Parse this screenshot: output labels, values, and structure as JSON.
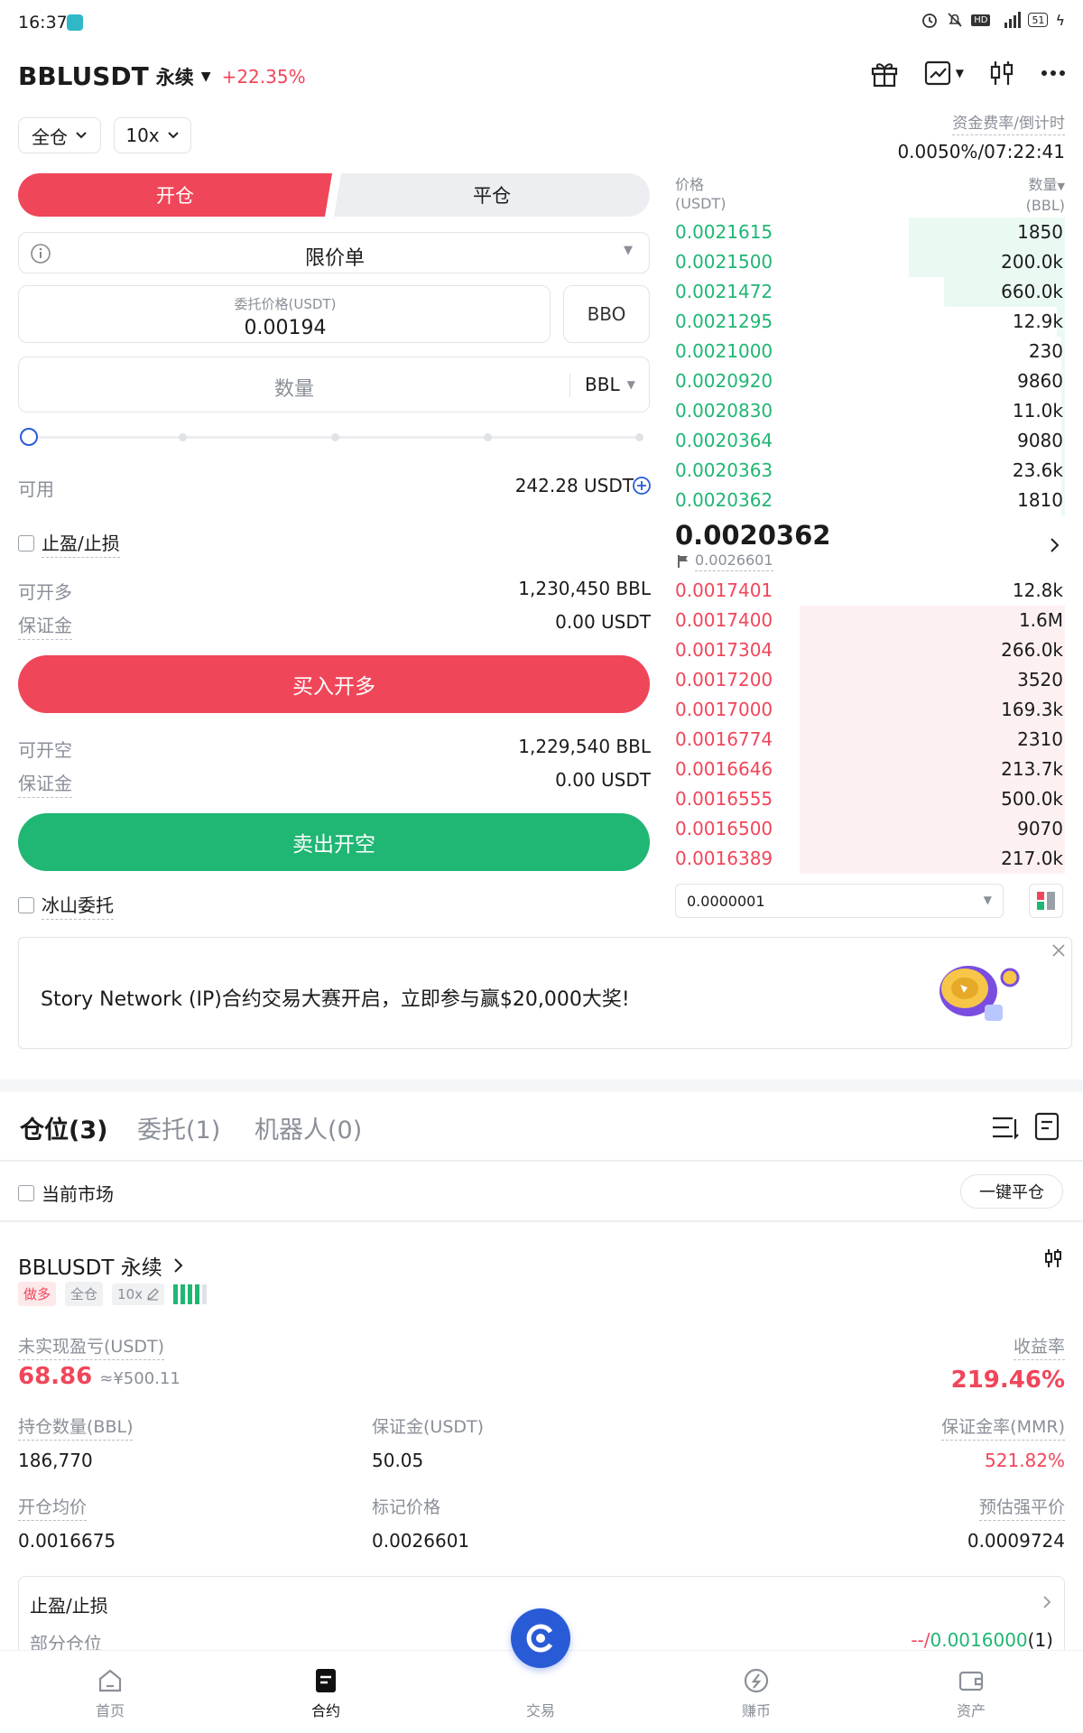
{
  "status_bar": {
    "time": "16:37",
    "battery": "51"
  },
  "header": {
    "symbol": "BBLUSDT",
    "type": "永续",
    "change": "+22.35%"
  },
  "margin_mode": "全仓",
  "leverage": "10x",
  "funding": {
    "label": "资金费率/倒计时",
    "value": "0.0050%/07:22:41"
  },
  "order_tabs": {
    "open": "开仓",
    "close": "平仓"
  },
  "order_type": "限价单",
  "price_input": {
    "label": "委托价格(USDT)",
    "value": "0.00194",
    "bbo": "BBO"
  },
  "qty_input": {
    "placeholder": "数量",
    "unit": "BBL"
  },
  "slider_level": 0,
  "available": {
    "label": "可用",
    "value": "242.28 USDT"
  },
  "tpsl_label": "止盈/止损",
  "long": {
    "can_open_label": "可开多",
    "can_open_value": "1,230,450 BBL",
    "margin_label": "保证金",
    "margin_value": "0.00 USDT",
    "button": "买入开多"
  },
  "short": {
    "can_open_label": "可开空",
    "can_open_value": "1,229,540 BBL",
    "margin_label": "保证金",
    "margin_value": "0.00 USDT",
    "button": "卖出开空"
  },
  "iceberg_label": "冰山委托",
  "orderbook": {
    "price_header": "价格",
    "price_unit": "(USDT)",
    "qty_header": "数量",
    "qty_unit": "(BBL)",
    "asks": [
      {
        "price": "0.0021615",
        "qty": "1850",
        "depth": 0.4
      },
      {
        "price": "0.0021500",
        "qty": "200.0k",
        "depth": 0.4
      },
      {
        "price": "0.0021472",
        "qty": "660.0k",
        "depth": 0.31
      },
      {
        "price": "0.0021295",
        "qty": "12.9k",
        "depth": 0.02
      },
      {
        "price": "0.0021000",
        "qty": "230",
        "depth": 0.01
      },
      {
        "price": "0.0020920",
        "qty": "9860",
        "depth": 0.01
      },
      {
        "price": "0.0020830",
        "qty": "11.0k",
        "depth": 0.01
      },
      {
        "price": "0.0020364",
        "qty": "9080",
        "depth": 0.01
      },
      {
        "price": "0.0020363",
        "qty": "23.6k",
        "depth": 0.01
      },
      {
        "price": "0.0020362",
        "qty": "1810",
        "depth": 0.01
      }
    ],
    "last_price": "0.0020362",
    "mark_price": "0.0026601",
    "bids": [
      {
        "price": "0.0017401",
        "qty": "12.8k",
        "depth": 0
      },
      {
        "price": "0.0017400",
        "qty": "1.6M",
        "depth": 0.68
      },
      {
        "price": "0.0017304",
        "qty": "266.0k",
        "depth": 0.68
      },
      {
        "price": "0.0017200",
        "qty": "3520",
        "depth": 0.68
      },
      {
        "price": "0.0017000",
        "qty": "169.3k",
        "depth": 0.68
      },
      {
        "price": "0.0016774",
        "qty": "2310",
        "depth": 0.68
      },
      {
        "price": "0.0016646",
        "qty": "213.7k",
        "depth": 0.68
      },
      {
        "price": "0.0016555",
        "qty": "500.0k",
        "depth": 0.68
      },
      {
        "price": "0.0016500",
        "qty": "9070",
        "depth": 0.68
      },
      {
        "price": "0.0016389",
        "qty": "217.0k",
        "depth": 0.68
      }
    ],
    "precision": "0.0000001"
  },
  "banner": {
    "text": "Story Network (IP)合约交易大赛开启，立即参与赢$20,000大奖!"
  },
  "position_tabs": {
    "positions": "仓位(3)",
    "orders": "委托(1)",
    "bots": "机器人(0)"
  },
  "current_market_label": "当前市场",
  "close_all_button": "一键平仓",
  "position": {
    "symbol": "BBLUSDT 永续",
    "side": "做多",
    "mode": "全仓",
    "leverage": "10x",
    "pnl_label": "未实现盈亏(USDT)",
    "pnl": "68.86",
    "pnl_cny": "≈¥500.11",
    "roe_label": "收益率",
    "roe": "219.46%",
    "size_label": "持仓数量(BBL)",
    "size": "186,770",
    "margin_label": "保证金(USDT)",
    "margin": "50.05",
    "mmr_label": "保证金率(MMR)",
    "mmr": "521.82%",
    "entry_label": "开仓均价",
    "entry": "0.0016675",
    "mark_label": "标记价格",
    "mark": "0.0026601",
    "liq_label": "预估强平价",
    "liq": "0.0009724",
    "tpsl_title": "止盈/止损",
    "partial_label": "部分仓位",
    "partial_prefix": "--/",
    "partial_value": "0.0016000",
    "partial_count": "(1)"
  },
  "bottom_nav": {
    "home": "首页",
    "futures": "合约",
    "trade": "交易",
    "earn": "赚币",
    "assets": "资产"
  }
}
